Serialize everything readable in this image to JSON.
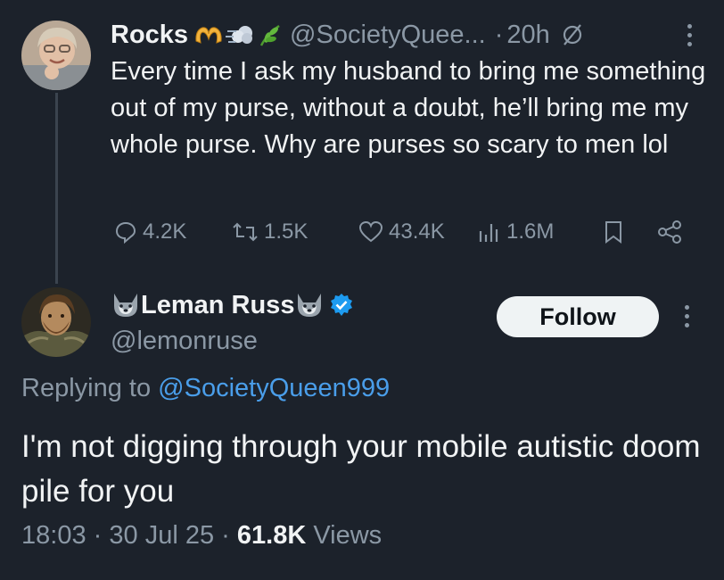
{
  "tweet1": {
    "display_name": "Rocks",
    "handle": "@SocietyQuee...",
    "separator": "·",
    "time": "20h",
    "text": "Every time I ask my husband to bring me something out of my purse, without a doubt, he’ll bring me my whole purse. Why are purses so scary to men lol",
    "name_emojis": [
      "heart-hands-icon",
      "dash-icon",
      "herb-icon"
    ],
    "stats": {
      "replies": "4.2K",
      "reposts": "1.5K",
      "likes": "43.4K",
      "views": "1.6M"
    }
  },
  "tweet2": {
    "display_name": "Leman Russ",
    "name_emojis": [
      "wolf-icon",
      "wolf-icon",
      "verified-badge-icon"
    ],
    "handle": "@lemonruse",
    "follow_label": "Follow",
    "replying_prefix": "Replying to",
    "replying_handle": "@SocietyQueen999",
    "text": "I'm not digging through your mobile autistic doom pile for you",
    "time": "18:03",
    "separator": "·",
    "date": "30 Jul 25",
    "views_count": "61.8K",
    "views_label": "Views"
  },
  "colors": {
    "background": "#1c222b",
    "text_primary": "#f1f3f4",
    "text_secondary": "#8b98a5",
    "link": "#4a9eea",
    "verified": "#1d9bf0",
    "follow_bg": "#eff3f4"
  }
}
